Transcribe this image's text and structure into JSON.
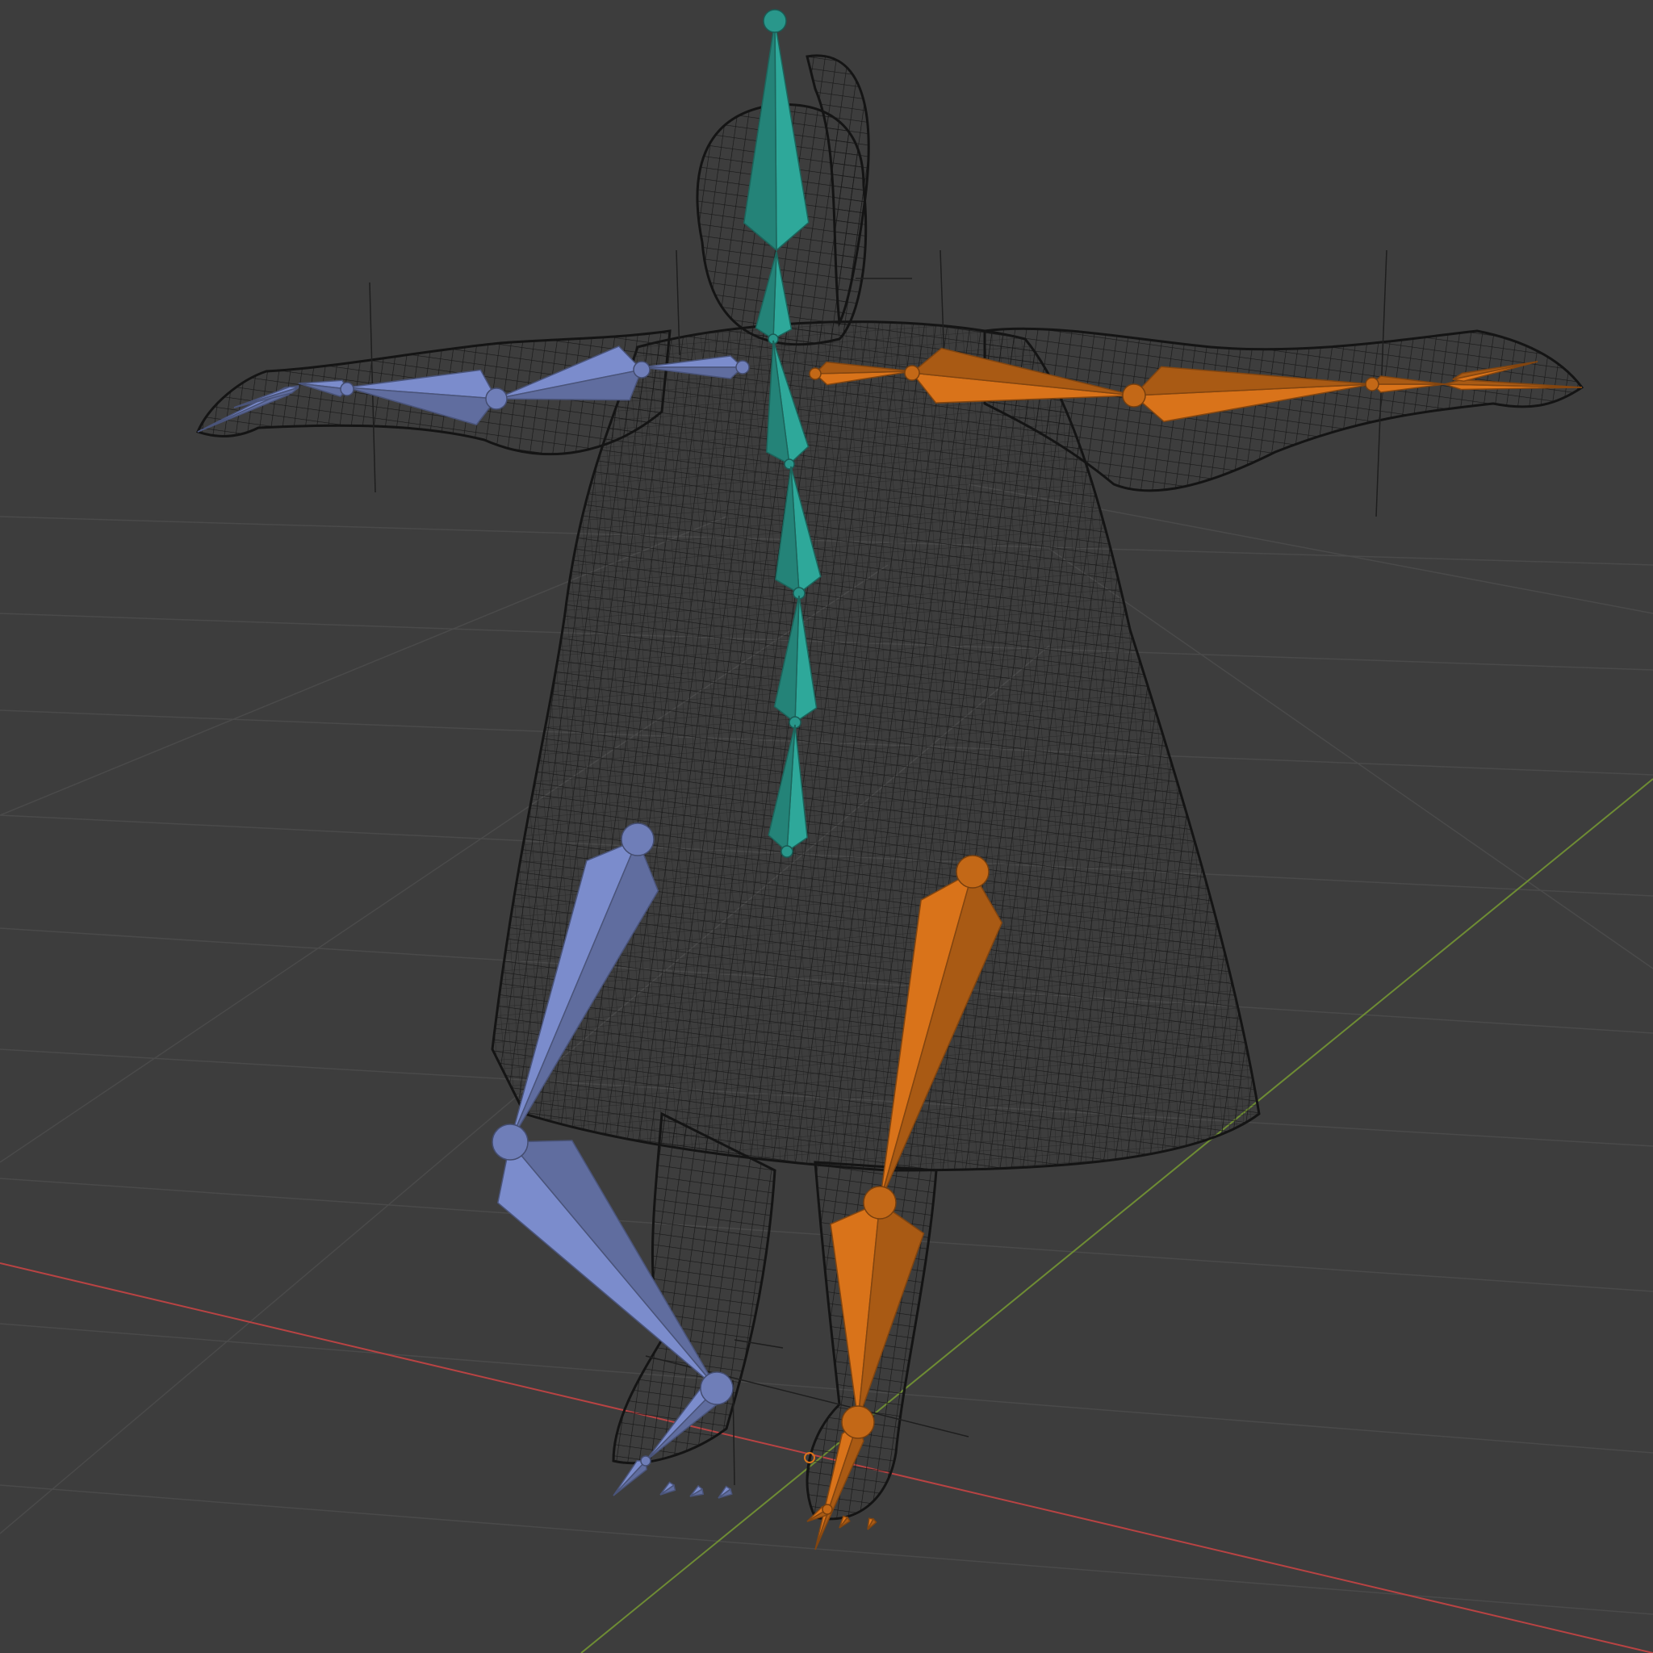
{
  "viewport": {
    "view": "3d-viewport",
    "shading": "wireframe",
    "background_color": "#3d3d3d",
    "grid_color": "#4a4a4a",
    "x_axis_color": "#c94a4a",
    "y_axis_color": "#7a9a3a"
  },
  "mesh": {
    "object": "character-mesh",
    "wire_color": "#1a1a1a"
  },
  "armature": {
    "bone_shape": "octahedral",
    "colors": {
      "center": "#2ea89a",
      "left": "#7b8ccc",
      "right": "#d9731a"
    },
    "chains": [
      {
        "side": "center",
        "name": "spine-chain"
      },
      {
        "side": "left",
        "name": "left-arm-chain"
      },
      {
        "side": "right",
        "name": "right-arm-chain"
      },
      {
        "side": "left",
        "name": "left-leg-chain"
      },
      {
        "side": "right",
        "name": "right-leg-chain"
      }
    ]
  }
}
